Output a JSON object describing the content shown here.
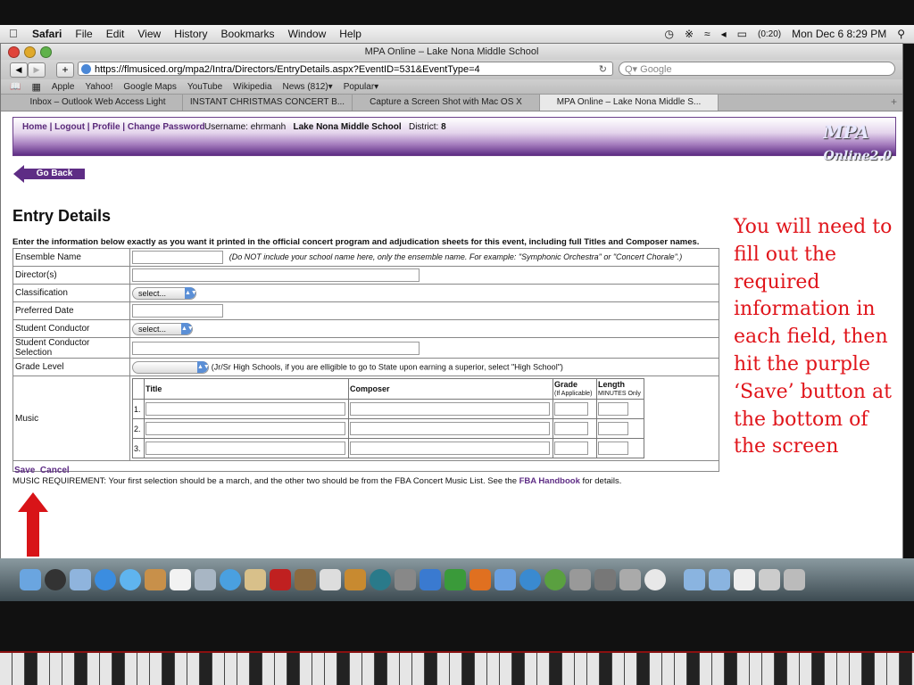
{
  "menubar": {
    "app": "Safari",
    "items": [
      "File",
      "Edit",
      "View",
      "History",
      "Bookmarks",
      "Window",
      "Help"
    ],
    "battery": "(0:20)",
    "clock": "Mon Dec 6  8:29 PM"
  },
  "window": {
    "title": "MPA Online – Lake Nona Middle School",
    "url": "https://flmusiced.org/mpa2/Intra/Directors/EntryDetails.aspx?EventID=531&EventType=4",
    "search_placeholder": "Q▾ Google",
    "bookmarks": [
      "Apple",
      "Yahoo!",
      "Google Maps",
      "YouTube",
      "Wikipedia",
      "News (812)▾",
      "Popular▾"
    ],
    "tabs": [
      "Inbox – Outlook Web Access Light",
      "INSTANT CHRISTMAS CONCERT B...",
      "Capture a Screen Shot with Mac OS X",
      "MPA Online – Lake Nona Middle S..."
    ]
  },
  "site": {
    "nav": [
      "Home",
      "Logout",
      "Profile",
      "Change Password"
    ],
    "username_label": "Username:",
    "username": "ehrmanh",
    "school": "Lake Nona Middle School",
    "district_label": "District:",
    "district": "8",
    "logo_main": "MPA",
    "logo_sub": "Online",
    "logo_version": "2.0",
    "go_back": "Go Back"
  },
  "form": {
    "heading": "Entry Details",
    "instruction": "Enter the information below exactly as you want it printed in the official concert program and adjudication sheets for this event, including full Titles and Composer names.",
    "fields": {
      "ensemble_name": "Ensemble Name",
      "ensemble_hint": "(Do NOT include your school name here, only the ensemble name. For example: \"Symphonic Orchestra\" or \"Concert Chorale\".)",
      "directors": "Director(s)",
      "classification": "Classification",
      "classification_value": "select...",
      "preferred_date": "Preferred Date",
      "student_conductor": "Student Conductor",
      "student_conductor_value": "select...",
      "student_conductor_selection": "Student Conductor Selection",
      "grade_level": "Grade Level",
      "grade_level_hint": "(Jr/Sr High Schools, if you are elligible to go to State upon earning a superior, select \"High School\")",
      "music": "Music"
    },
    "music_table": {
      "col_title": "Title",
      "col_composer": "Composer",
      "col_grade": "Grade",
      "col_grade_sub": "(If Applicable)",
      "col_length": "Length",
      "col_length_sub": "MINUTES Only",
      "rows": [
        "1.",
        "2.",
        "3."
      ]
    },
    "save": "Save",
    "cancel": "Cancel",
    "requirement": "MUSIC REQUIREMENT: Your first selection should be a march, and the other two should be from the FBA Concert Music List. See the",
    "handbook": "FBA Handbook",
    "requirement_end": "for details."
  },
  "annotation": "You will need to fill out the required information in each field, then hit the purple ‘Save’ button at the bottom of the screen",
  "colors": {
    "brand_purple": "#5e2d85",
    "annotation_red": "#e0141a"
  }
}
